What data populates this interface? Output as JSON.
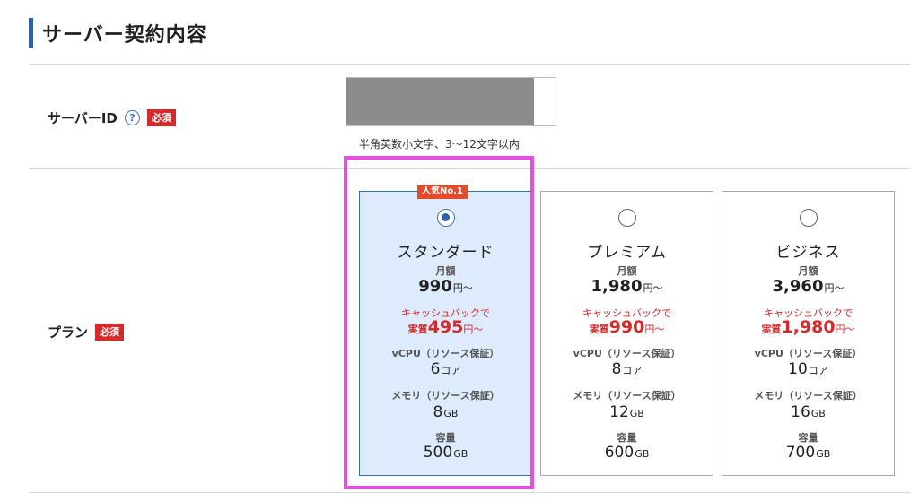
{
  "section": {
    "title": "サーバー契約内容"
  },
  "server_id": {
    "label": "サーバーID",
    "help": "?",
    "required": "必須",
    "hint": "半角英数小文字、3〜12文字以内",
    "value": ""
  },
  "plan_row": {
    "label": "プラン",
    "required": "必須"
  },
  "plans": [
    {
      "badge": "人気No.1",
      "name": "スタンダード",
      "selected": true,
      "monthly_label": "月額",
      "monthly_price": "990",
      "price_unit": "円〜",
      "cashback_label": "キャッシュバックで",
      "cashback_prefix": "実質",
      "cashback_price": "495",
      "cashback_unit": "円〜",
      "vcpu_label": "vCPU（リソース保証）",
      "vcpu_value": "6",
      "vcpu_unit": "コア",
      "memory_label": "メモリ（リソース保証）",
      "memory_value": "8",
      "memory_unit": "GB",
      "storage_label": "容量",
      "storage_value": "500",
      "storage_unit": "GB"
    },
    {
      "name": "プレミアム",
      "selected": false,
      "monthly_label": "月額",
      "monthly_price": "1,980",
      "price_unit": "円〜",
      "cashback_label": "キャッシュバックで",
      "cashback_prefix": "実質",
      "cashback_price": "990",
      "cashback_unit": "円〜",
      "vcpu_label": "vCPU（リソース保証）",
      "vcpu_value": "8",
      "vcpu_unit": "コア",
      "memory_label": "メモリ（リソース保証）",
      "memory_value": "12",
      "memory_unit": "GB",
      "storage_label": "容量",
      "storage_value": "600",
      "storage_unit": "GB"
    },
    {
      "name": "ビジネス",
      "selected": false,
      "monthly_label": "月額",
      "monthly_price": "3,960",
      "price_unit": "円〜",
      "cashback_label": "キャッシュバックで",
      "cashback_prefix": "実質",
      "cashback_price": "1,980",
      "cashback_unit": "円〜",
      "vcpu_label": "vCPU（リソース保証）",
      "vcpu_value": "10",
      "vcpu_unit": "コア",
      "memory_label": "メモリ（リソース保証）",
      "memory_value": "16",
      "memory_unit": "GB",
      "storage_label": "容量",
      "storage_value": "700",
      "storage_unit": "GB"
    }
  ],
  "colors": {
    "accent": "#2f5fa5",
    "required": "#d42a2a",
    "popular": "#e34b2c",
    "selected_bg": "#ddebfd",
    "highlight": "#e44ee3"
  }
}
